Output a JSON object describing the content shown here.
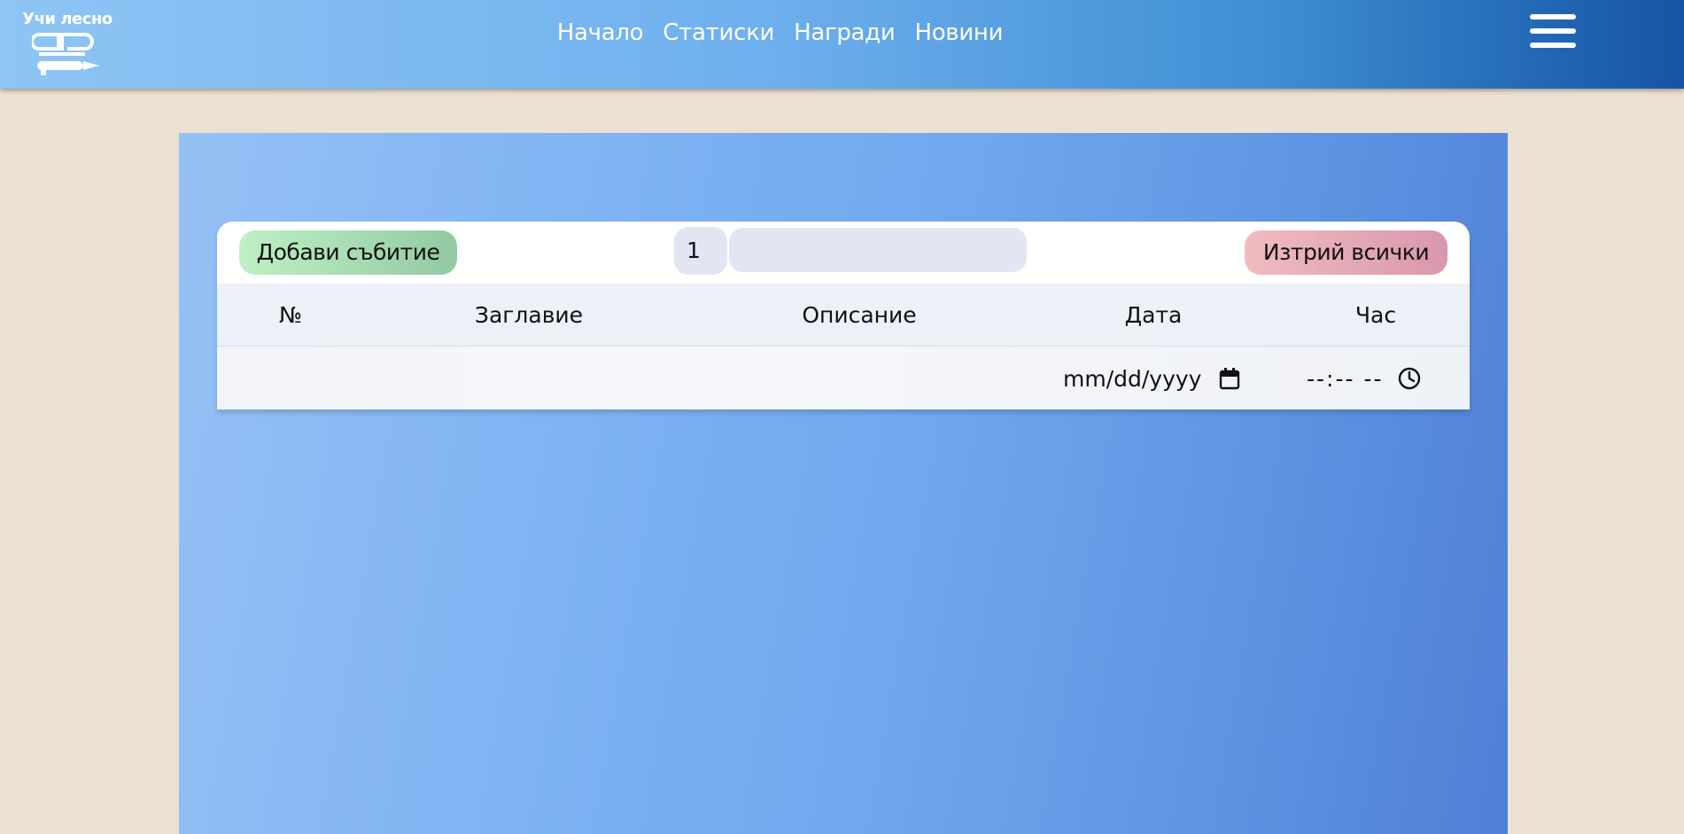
{
  "header": {
    "logo_text": "Учи лесно",
    "nav": [
      {
        "label": "Начало"
      },
      {
        "label": "Статиски"
      },
      {
        "label": "Награди"
      },
      {
        "label": "Новини"
      }
    ],
    "menu_icon": "hamburger-menu-icon"
  },
  "toolbar": {
    "add_label": "Добави събитие",
    "page_value": "1",
    "search_value": "",
    "delete_all_label": "Изтрий всички"
  },
  "table": {
    "columns": [
      "№",
      "Заглавие",
      "Описание",
      "Дата",
      "Час"
    ],
    "new_row": {
      "date_placeholder": "mm/dd/yyyy",
      "time_placeholder": "--:-- --",
      "date_icon": "calendar-icon",
      "time_icon": "clock-icon"
    }
  },
  "colors": {
    "page_bg": "#ece0d0",
    "header_start": "#8ec5f4",
    "header_end": "#1554a4",
    "add_button": "#bff0c4",
    "delete_button": "#f0bcbf"
  }
}
